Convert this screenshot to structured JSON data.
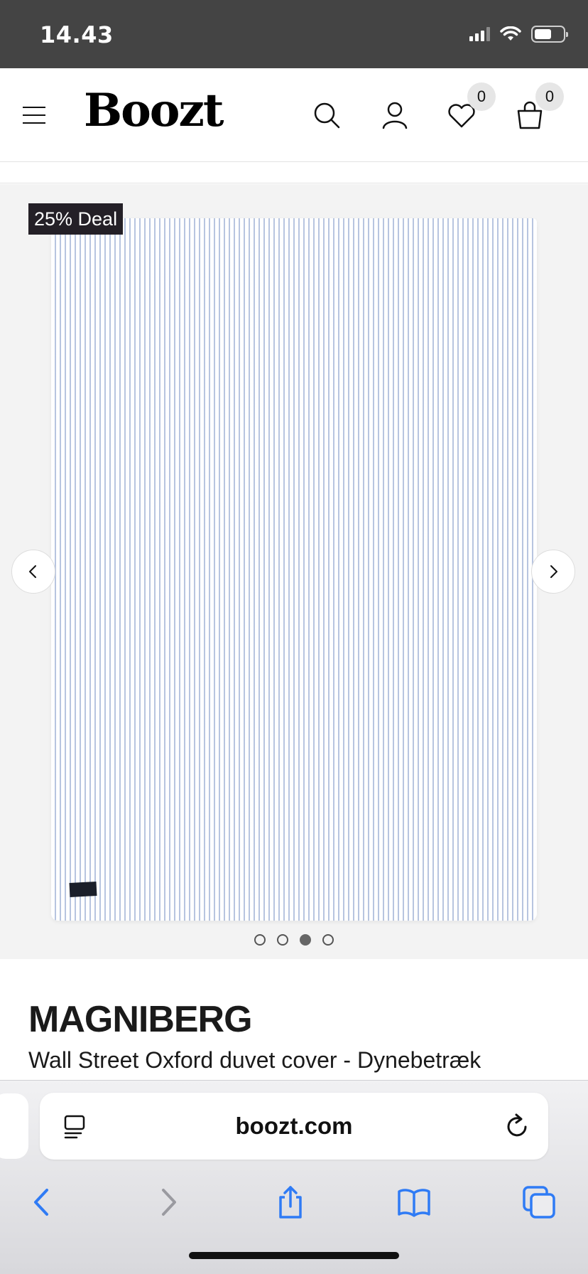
{
  "status_bar": {
    "time": "14.43"
  },
  "header": {
    "logo": "Boozt",
    "wishlist_count": "0",
    "cart_count": "0"
  },
  "gallery": {
    "deal_badge": "25% Deal",
    "image_alt": "Striped duvet cover",
    "slide_count": 4,
    "active_slide": 3
  },
  "product": {
    "brand": "MAGNIBERG",
    "title": "Wall Street Oxford duvet cover - Dynebetræk"
  },
  "browser": {
    "url": "boozt.com"
  },
  "colors": {
    "accent_blue": "#2f7bf5",
    "badge_bg": "#242027",
    "status_bar": "#444444"
  }
}
